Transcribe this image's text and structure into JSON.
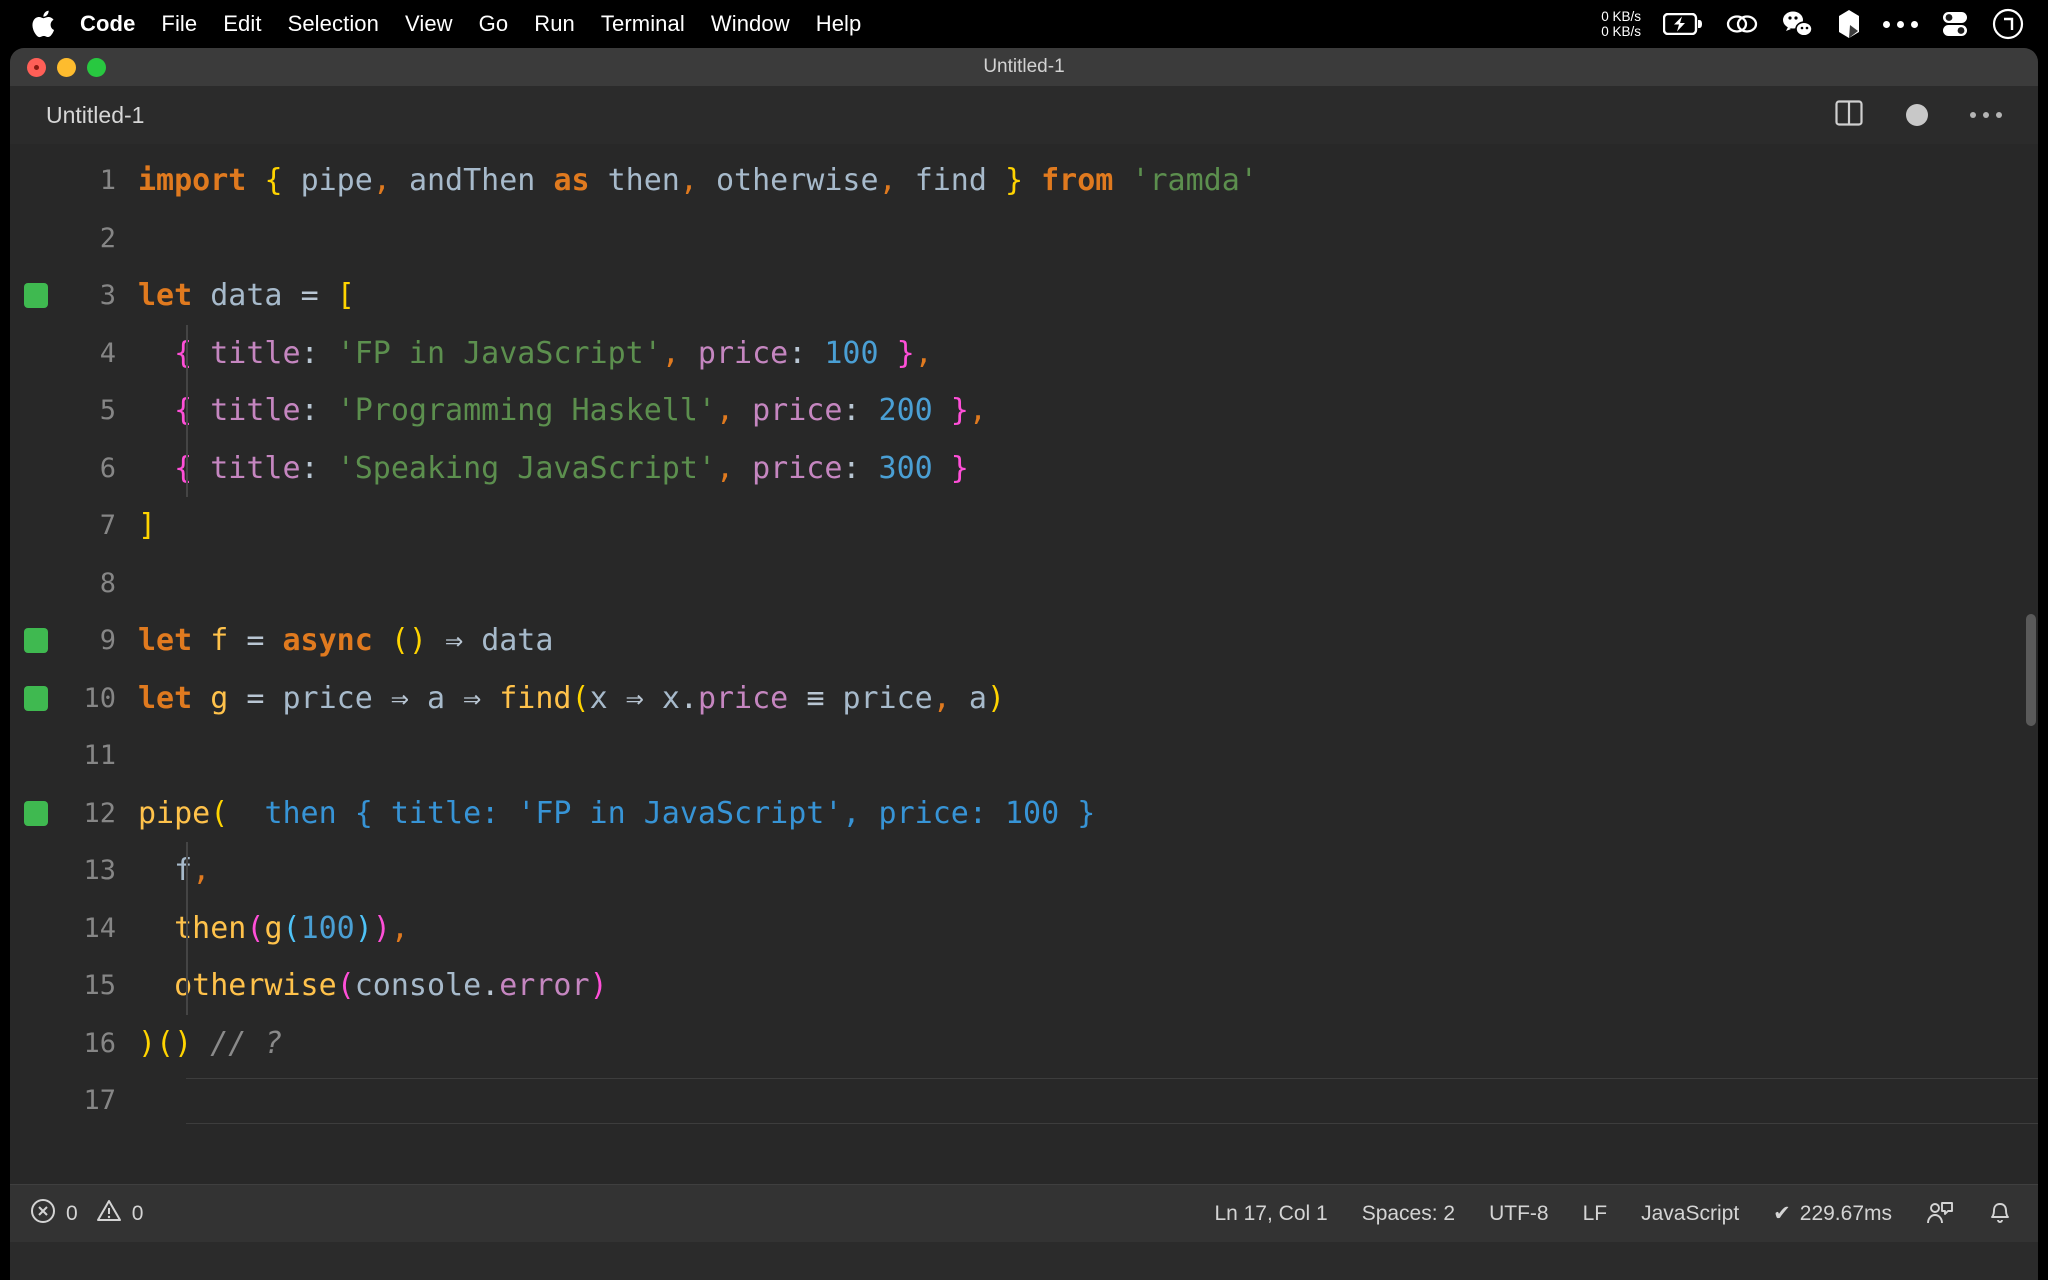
{
  "menubar": {
    "apple_icon": "apple-logo-icon",
    "items": [
      {
        "label": "Code",
        "bold": true
      },
      {
        "label": "File",
        "bold": false
      },
      {
        "label": "Edit",
        "bold": false
      },
      {
        "label": "Selection",
        "bold": false
      },
      {
        "label": "View",
        "bold": false
      },
      {
        "label": "Go",
        "bold": false
      },
      {
        "label": "Run",
        "bold": false
      },
      {
        "label": "Terminal",
        "bold": false
      },
      {
        "label": "Window",
        "bold": false
      },
      {
        "label": "Help",
        "bold": false
      }
    ],
    "network_up": "0 KB/s",
    "network_down": "0 KB/s",
    "status_icons": [
      "battery-charging-icon",
      "link-chain-icon",
      "wechat-icon",
      "cursor-shard-icon",
      "more-dots-icon",
      "control-center-icon",
      "siri-clock-icon"
    ]
  },
  "window": {
    "title": "Untitled-1",
    "traffic_lights": [
      "close-button",
      "minimize-button",
      "maximize-button"
    ]
  },
  "tabbar": {
    "tab_label": "Untitled-1",
    "actions": [
      "split-editor-icon",
      "unsaved-dot-icon",
      "more-actions-icon"
    ]
  },
  "editor": {
    "lines": [
      {
        "n": "1",
        "git": false,
        "indent": false
      },
      {
        "n": "2",
        "git": false,
        "indent": false
      },
      {
        "n": "3",
        "git": true,
        "indent": false
      },
      {
        "n": "4",
        "git": false,
        "indent": true
      },
      {
        "n": "5",
        "git": false,
        "indent": true
      },
      {
        "n": "6",
        "git": false,
        "indent": true
      },
      {
        "n": "7",
        "git": false,
        "indent": false
      },
      {
        "n": "8",
        "git": false,
        "indent": false
      },
      {
        "n": "9",
        "git": true,
        "indent": false
      },
      {
        "n": "10",
        "git": true,
        "indent": false
      },
      {
        "n": "11",
        "git": false,
        "indent": false
      },
      {
        "n": "12",
        "git": true,
        "indent": false
      },
      {
        "n": "13",
        "git": false,
        "indent": true
      },
      {
        "n": "14",
        "git": false,
        "indent": true
      },
      {
        "n": "15",
        "git": false,
        "indent": true
      },
      {
        "n": "16",
        "git": false,
        "indent": false
      },
      {
        "n": "17",
        "git": false,
        "indent": false
      }
    ],
    "source_text": [
      "import { pipe, andThen as then, otherwise, find } from 'ramda'",
      "",
      "let data = [",
      "  { title: 'FP in JavaScript', price: 100 },",
      "  { title: 'Programming Haskell', price: 200 },",
      "  { title: 'Speaking JavaScript', price: 300 }",
      "]",
      "",
      "let f = async () => data",
      "let g = price => a => find(x => x.price === price, a)",
      "",
      "pipe(",
      "  f,",
      "  then(g(100)),",
      "  otherwise(console.error)",
      ")() // ?",
      ""
    ],
    "inline_hint": "then { title: 'FP in JavaScript', price: 100 }",
    "tok": {
      "import": "import",
      "pipe": "pipe",
      "andThen": "andThen",
      "as": "as",
      "then": "then",
      "otherwise": "otherwise",
      "find": "find",
      "from": "from",
      "ramda": "'ramda'",
      "let": "let",
      "data": "data",
      "title": "title",
      "price": "price",
      "s_fp": "'FP in JavaScript'",
      "s_haskell": "'Programming Haskell'",
      "s_speaking": "'Speaking JavaScript'",
      "n100": "100",
      "n200": "200",
      "n300": "300",
      "f": "f",
      "g": "g",
      "async": "async",
      "a": "a",
      "x": "x",
      "console": "console",
      "error": "error",
      "arrow": "⇒",
      "eqeqeq": "≡",
      "comment": "// ?"
    }
  },
  "statusbar": {
    "errors_icon": "error-circle-icon",
    "errors": "0",
    "warnings_icon": "warning-triangle-icon",
    "warnings": "0",
    "cursor_position": "Ln 17, Col 1",
    "indentation": "Spaces: 2",
    "encoding": "UTF-8",
    "eol": "LF",
    "language": "JavaScript",
    "quokka_check": "✔",
    "quokka_time": "229.67ms",
    "feedback_icon": "feedback-person-icon",
    "bell_icon": "notifications-bell-icon"
  },
  "colors": {
    "editor_bg": "#282828",
    "chrome_bg": "#2b2b2b",
    "titlebar_bg": "#3b3b3b",
    "statusbar_bg": "#333333",
    "git_added": "#3fb950",
    "keyword": "#e07a1f",
    "string": "#5c8f4e",
    "number": "#4a9fd4",
    "function": "#ffc24b",
    "property": "#c586c0",
    "bracket_yellow": "#ffd400",
    "bracket_pink": "#ff4fd8",
    "bracket_cyan": "#4fc3f7",
    "inline_hint": "#3794d6"
  }
}
